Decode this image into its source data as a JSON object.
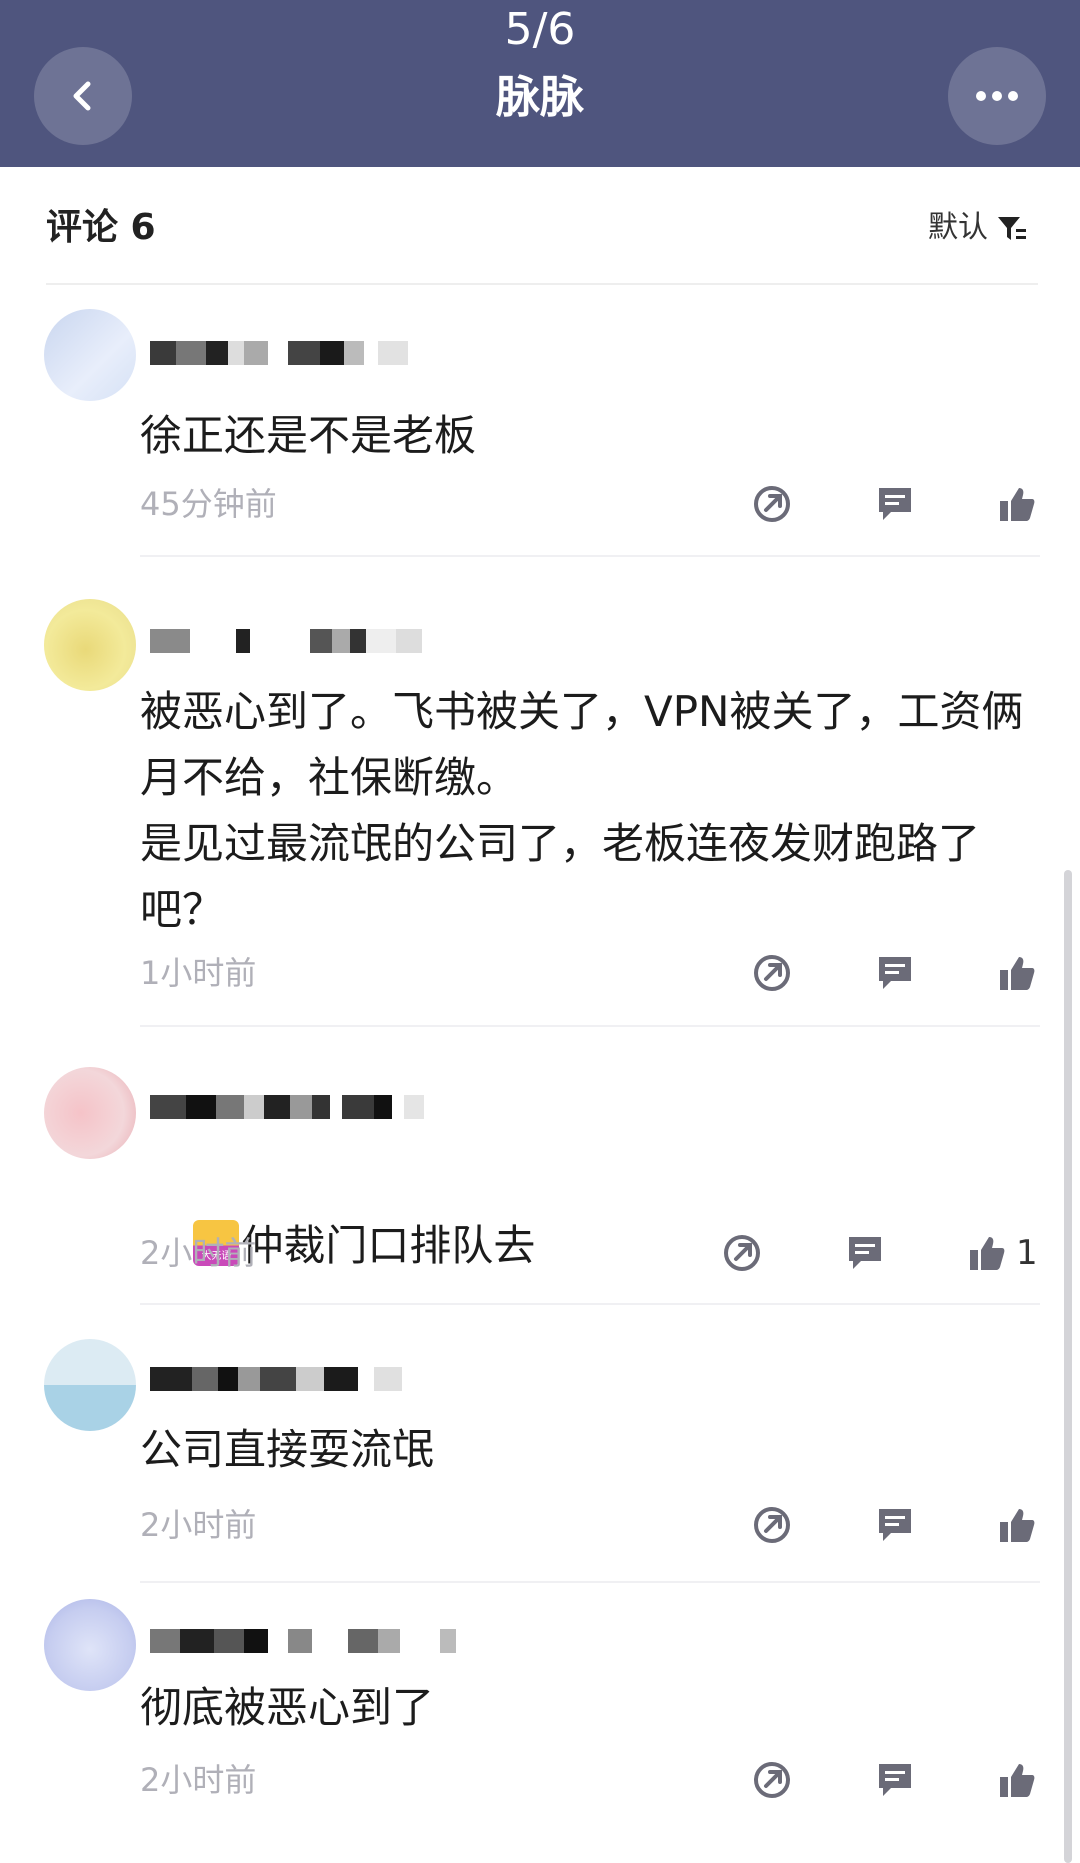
{
  "header": {
    "page_counter": "5/6",
    "title": "脉脉",
    "back_icon": "chevron-left-icon",
    "more_icon": "more-horizontal-icon"
  },
  "comments_section": {
    "title": "评论 6",
    "sort_label": "默认",
    "sort_icon": "filter-sort-icon"
  },
  "comments": [
    {
      "text": "徐正还是不是老板",
      "time": "45分钟前",
      "like_count": ""
    },
    {
      "text": "被恶心到了。飞书被关了，VPN被关了，工资俩月不给，社保断缴。\n是见过最流氓的公司了，老板连夜发财跑路了吧？",
      "time": "1小时前",
      "like_count": ""
    },
    {
      "text": "仲裁门口排队去",
      "time": "2小时前",
      "like_count": "1",
      "emoji_label": "大无语"
    },
    {
      "text": "公司直接耍流氓",
      "time": "2小时前",
      "like_count": ""
    },
    {
      "text": "彻底被恶心到了",
      "time": "2小时前",
      "like_count": ""
    }
  ],
  "colors": {
    "header_bg": "#4f557e",
    "text": "#1c1c1c",
    "muted": "#b0b0b8",
    "icon": "#6b6b78"
  }
}
